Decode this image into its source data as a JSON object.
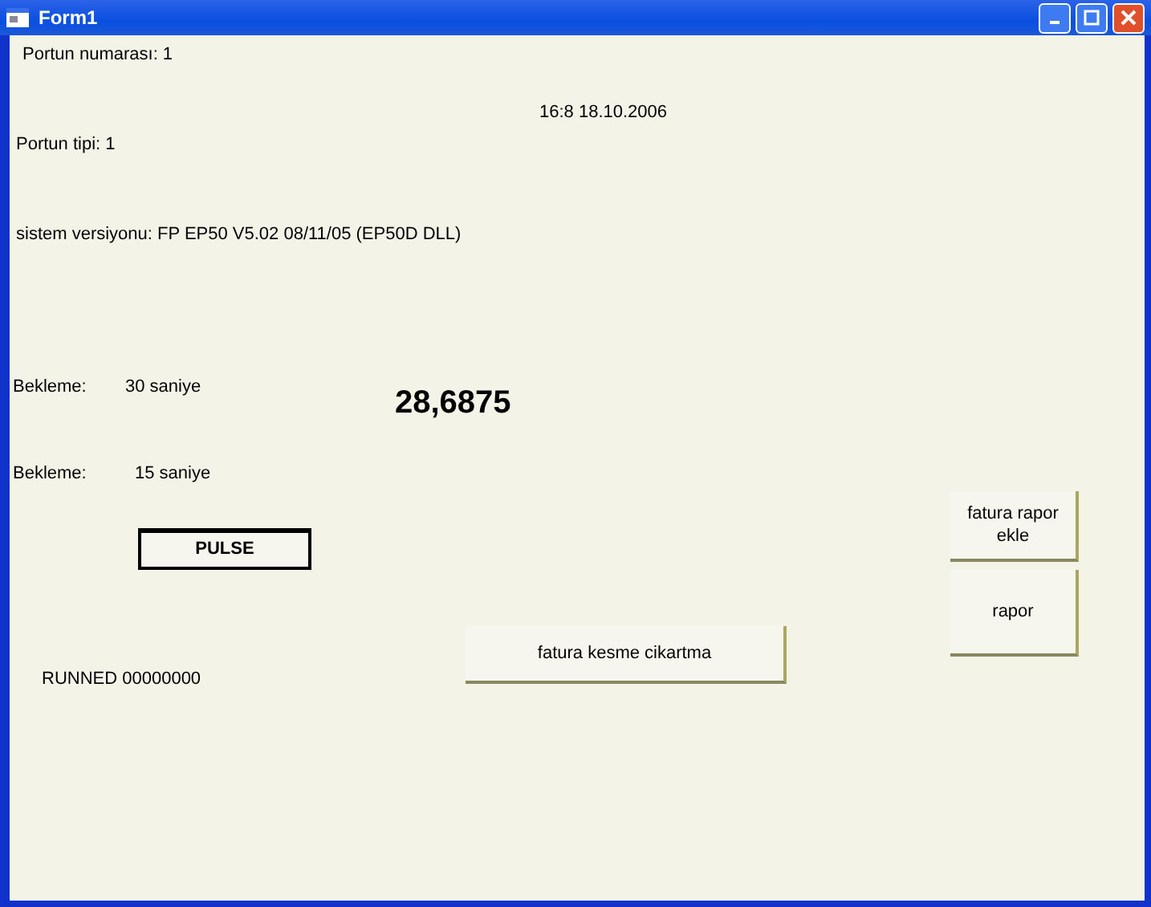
{
  "window": {
    "title": "Form1"
  },
  "labels": [
    {
      "kind": "plain",
      "text": "Portun numarası: 1"
    },
    {
      "kind": "plain",
      "text": "16:8 18.10.2006"
    },
    {
      "kind": "plain",
      "text": "Portun tipi: 1"
    },
    {
      "kind": "plain",
      "text": "sistem versiyonu: FP EP50 V5.02 08/11/05 (EP50D DLL)"
    },
    {
      "kind": "plain",
      "text": "Bekleme:"
    },
    {
      "kind": "plain",
      "text": "30 saniye"
    },
    {
      "kind": "big",
      "text": "28,6875"
    },
    {
      "kind": "plain",
      "text": "Bekleme:"
    },
    {
      "kind": "plain",
      "text": "15 saniye"
    },
    {
      "kind": "plain",
      "text": "RUNNED 00000000"
    }
  ],
  "buttons": [
    {
      "kind": "focused",
      "label": "PULSE"
    },
    {
      "kind": "normal",
      "label": "fatura kesme cikartma"
    },
    {
      "kind": "normal",
      "label": "fatura rapor  ekle"
    },
    {
      "kind": "normal",
      "label": "rapor"
    }
  ]
}
